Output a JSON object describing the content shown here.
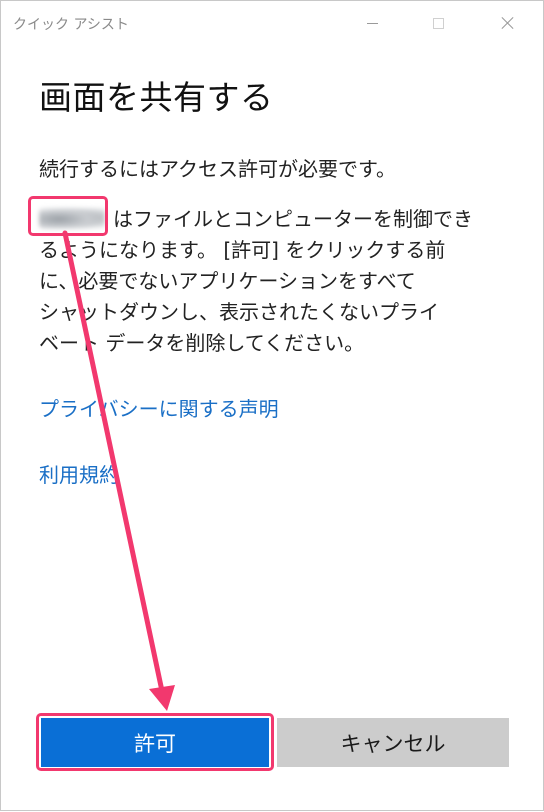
{
  "window": {
    "title": "クイック アシスト"
  },
  "main": {
    "heading": "画面を共有する",
    "intro": "続行するにはアクセス許可が必要です。",
    "body_lines": [
      "はファイルとコンピューターを制御でき",
      "るようになります。 [許可] をクリックする前",
      "に、必要でないアプリケーションをすべて",
      "シャットダウンし、表示されたくないプライ",
      "ベート データを削除してください。"
    ],
    "privacy_link": "プライバシーに関する声明",
    "terms_link": "利用規約"
  },
  "buttons": {
    "allow": "許可",
    "cancel": "キャンセル"
  },
  "colors": {
    "accent": "#0a6fd6",
    "link": "#1a6fc6",
    "annotation": "#f2386e"
  },
  "icons": [
    "minimize-icon",
    "maximize-icon",
    "close-icon"
  ]
}
